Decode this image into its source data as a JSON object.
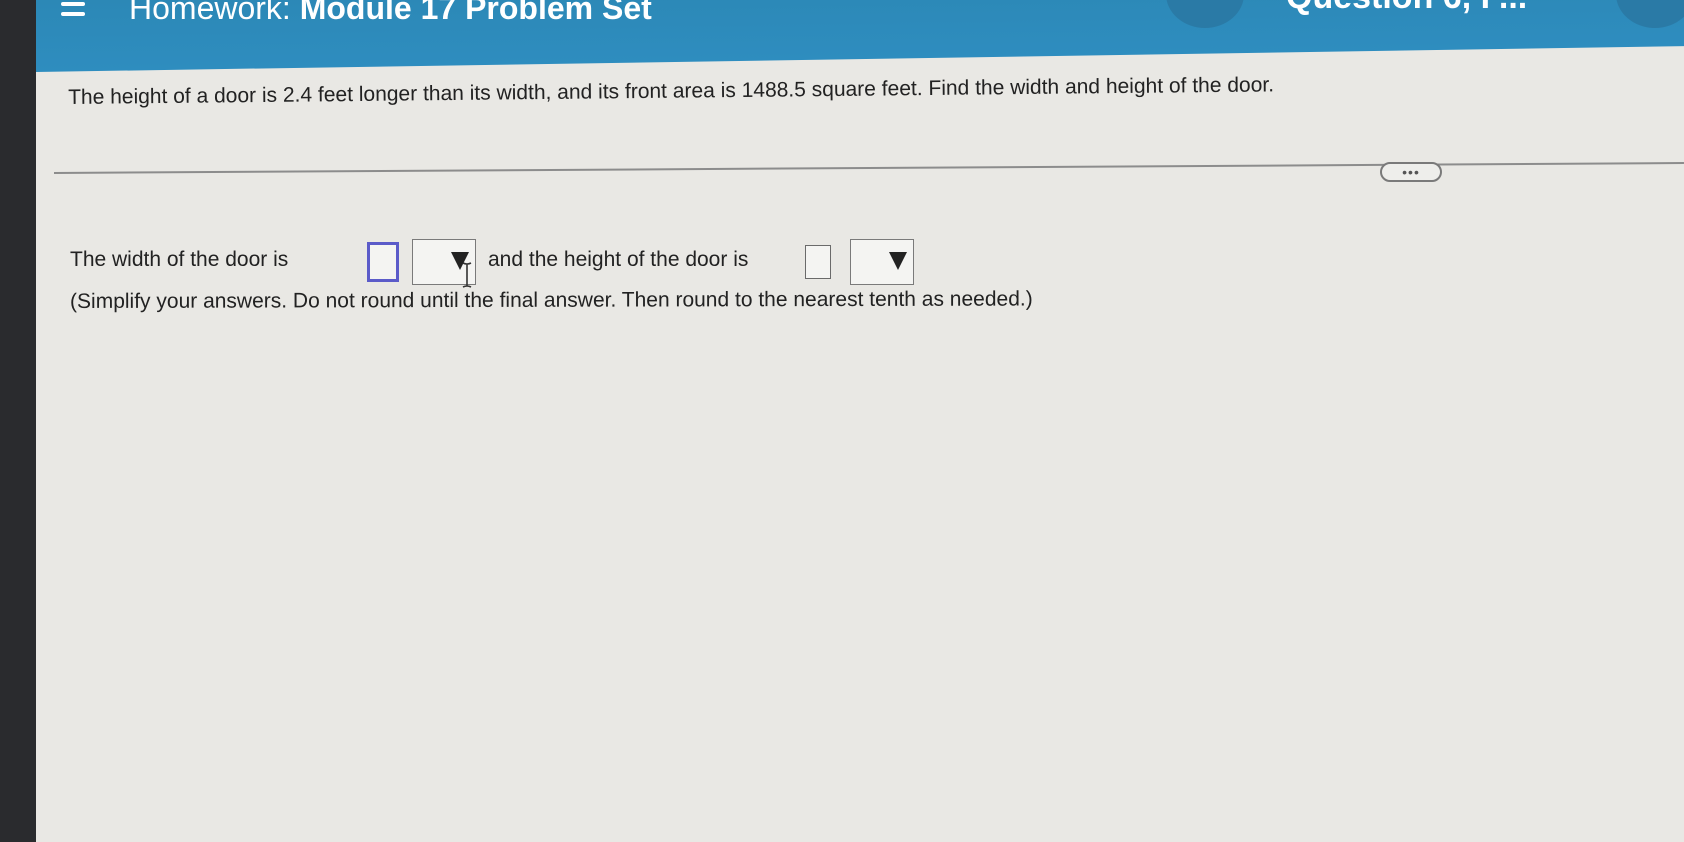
{
  "header": {
    "menu_icon": "hamburger-icon",
    "title_prefix": "Homework:",
    "title_rest": "Module 17 Problem Set",
    "question_label": "Question 6, P..."
  },
  "question": {
    "text": "The height of a door is 2.4 feet longer than its width, and its front area is 1488.5 square feet. Find the width and height of the door."
  },
  "more_button": {
    "label": "•••"
  },
  "answer": {
    "part1": "The width of the door is",
    "width_value": "",
    "width_unit": "",
    "part2": "and the height of the door is",
    "height_value": "",
    "height_unit": "",
    "instruction": "(Simplify your answers. Do not round until the final answer. Then round to the nearest tenth as needed.)"
  },
  "colors": {
    "header_bg": "#2e8dbf",
    "page_bg": "#e9e8e4",
    "focus_border": "#5b5bc9"
  }
}
